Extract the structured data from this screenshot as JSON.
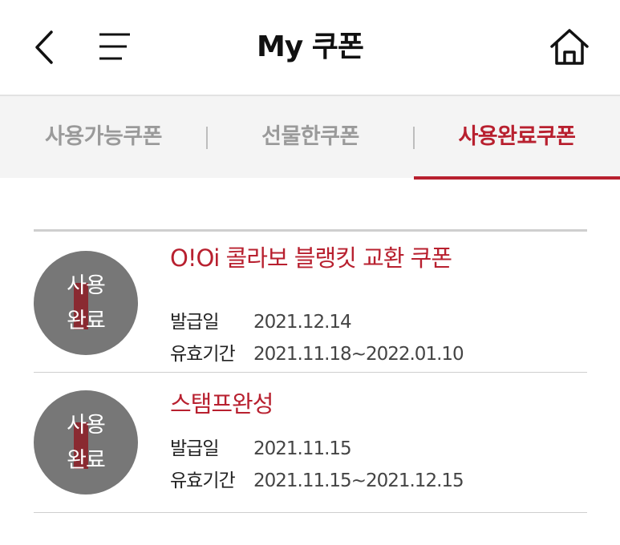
{
  "header": {
    "title": "My 쿠폰",
    "back_icon": "chevron-left-icon",
    "menu_icon": "menu-icon",
    "home_icon": "home-icon"
  },
  "tabs": [
    {
      "label": "사용가능쿠폰",
      "active": false
    },
    {
      "label": "선물한쿠폰",
      "active": false
    },
    {
      "label": "사용완료쿠폰",
      "active": true
    }
  ],
  "coupons": [
    {
      "stamp": "사용\n완료",
      "title": "O!Oi 콜라보 블랭킷 교환 쿠폰",
      "issue_label": "발급일",
      "issue_date": "2021.12.14",
      "valid_label": "유효기간",
      "valid_period": "2021.11.18~2022.01.10"
    },
    {
      "stamp": "사용\n완료",
      "title": "스탬프완성",
      "issue_label": "발급일",
      "issue_date": "2021.11.15",
      "valid_label": "유효기간",
      "valid_period": "2021.11.15~2021.12.15"
    }
  ],
  "colors": {
    "accent": "#b8202f",
    "inactive_tab": "#9a9a9a",
    "stamp_gray": "#777777"
  }
}
